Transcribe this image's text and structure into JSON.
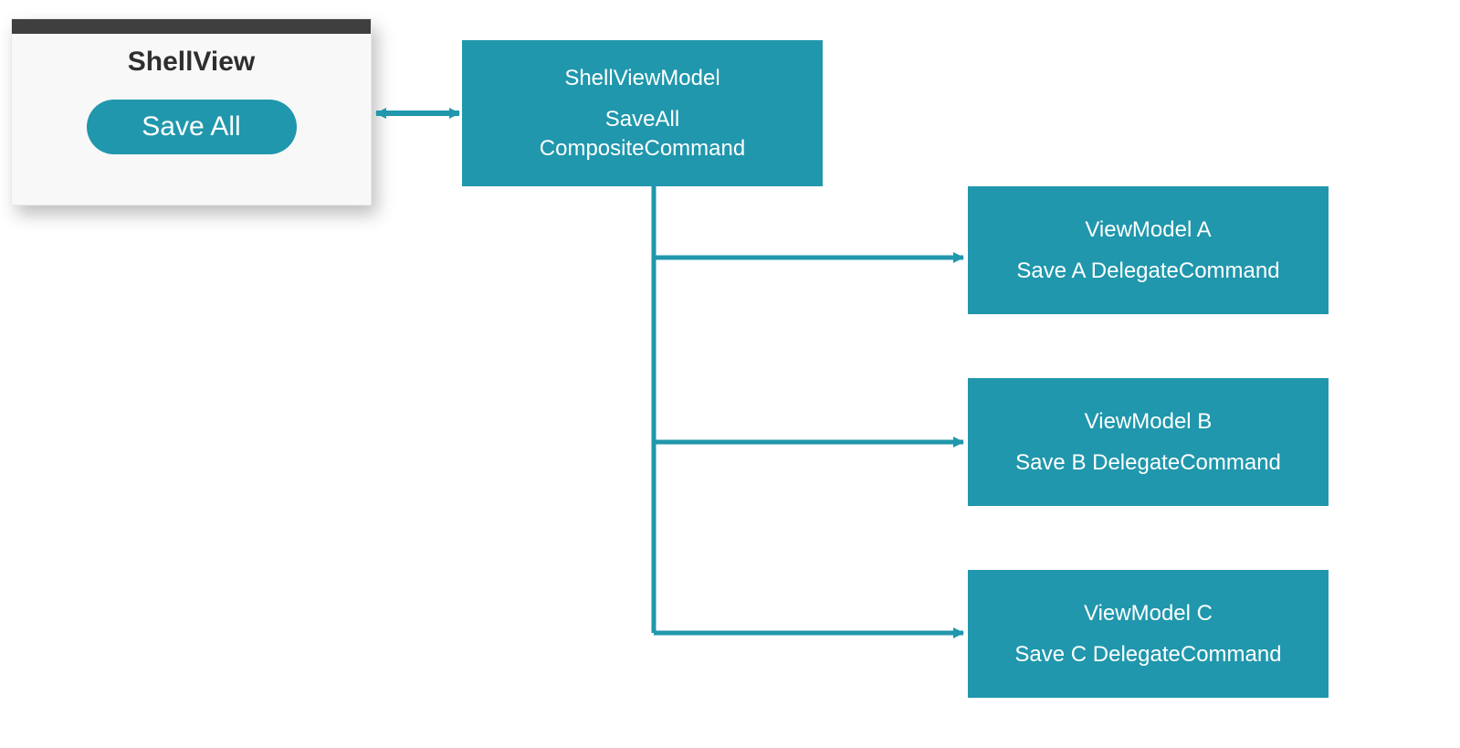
{
  "colors": {
    "teal": "#2097ac",
    "titlebar": "#3f3f3f",
    "window_bg": "#f8f8f8"
  },
  "shell_view": {
    "title": "ShellView",
    "button_label": "Save All"
  },
  "shell_view_model": {
    "line1": "ShellViewModel",
    "line2": "SaveAll",
    "line3": "CompositeCommand"
  },
  "view_models": [
    {
      "title": "ViewModel A",
      "command": "Save A DelegateCommand"
    },
    {
      "title": "ViewModel B",
      "command": "Save B DelegateCommand"
    },
    {
      "title": "ViewModel C",
      "command": "Save C DelegateCommand"
    }
  ]
}
